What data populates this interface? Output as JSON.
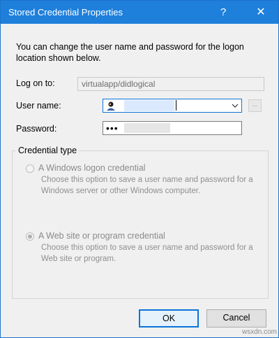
{
  "window": {
    "title": "Stored Credential Properties",
    "help_label": "?",
    "close_label": "✕"
  },
  "intro": "You can change the user name and password for the logon location shown below.",
  "logon": {
    "label": "Log on to:",
    "value": "virtualapp/didlogical"
  },
  "user": {
    "label": "User name:",
    "value": ""
  },
  "password": {
    "label": "Password:",
    "masked_value": "•••"
  },
  "browse_label": "...",
  "credential_type": {
    "legend": "Credential type",
    "options": [
      {
        "label": "A Windows logon credential",
        "description": "Choose this option to save a user name and password for a Windows server or other Windows computer.",
        "checked": false
      },
      {
        "label": "A Web site or program credential",
        "description": "Choose this option to save a user name and password for a Web site or program.",
        "checked": true
      }
    ]
  },
  "buttons": {
    "ok": "OK",
    "cancel": "Cancel"
  },
  "watermark": "wsxdn.com",
  "colors": {
    "titlebar": "#1e80db",
    "focus_border": "#0b74d7"
  }
}
